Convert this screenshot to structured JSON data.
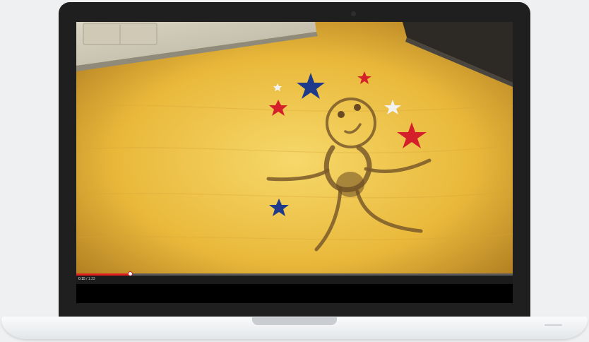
{
  "player": {
    "current_time": "0:15",
    "separator": " / ",
    "duration": "1:23",
    "progress_fraction": 0.125
  },
  "colors": {
    "progress": "#e02020",
    "star_red": "#d4202a",
    "star_blue": "#1f3a8a",
    "star_white": "#f2f2f2",
    "stain": "#7a5a2a",
    "table": "#e8b93a"
  },
  "icons": {
    "scrubber": "playhead-handle",
    "camera": "webcam-dot"
  }
}
